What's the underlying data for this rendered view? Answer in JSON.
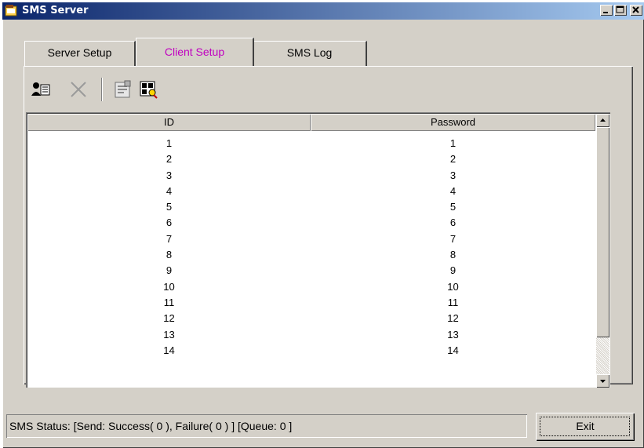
{
  "window": {
    "title": "SMS Server"
  },
  "tabs": [
    {
      "label": "Server Setup"
    },
    {
      "label": "Client Setup",
      "active": true
    },
    {
      "label": "SMS Log"
    }
  ],
  "toolbar": {
    "icons": [
      "add-user-icon",
      "delete-icon",
      "properties-icon",
      "search-icon"
    ]
  },
  "table": {
    "columns": [
      "ID",
      "Password"
    ],
    "rows": [
      [
        "1",
        "1"
      ],
      [
        "2",
        "2"
      ],
      [
        "3",
        "3"
      ],
      [
        "4",
        "4"
      ],
      [
        "5",
        "5"
      ],
      [
        "6",
        "6"
      ],
      [
        "7",
        "7"
      ],
      [
        "8",
        "8"
      ],
      [
        "9",
        "9"
      ],
      [
        "10",
        "10"
      ],
      [
        "11",
        "11"
      ],
      [
        "12",
        "12"
      ],
      [
        "13",
        "13"
      ],
      [
        "14",
        "14"
      ]
    ]
  },
  "status": {
    "text": "SMS Status: [Send: Success( 0 ), Failure( 0 ) ] [Queue: 0 ]"
  },
  "buttons": {
    "exit": "Exit"
  },
  "colors": {
    "titlebar_start": "#0a246a",
    "titlebar_end": "#a6caf0",
    "active_tab": "#c000c0",
    "face": "#d4d0c8"
  }
}
